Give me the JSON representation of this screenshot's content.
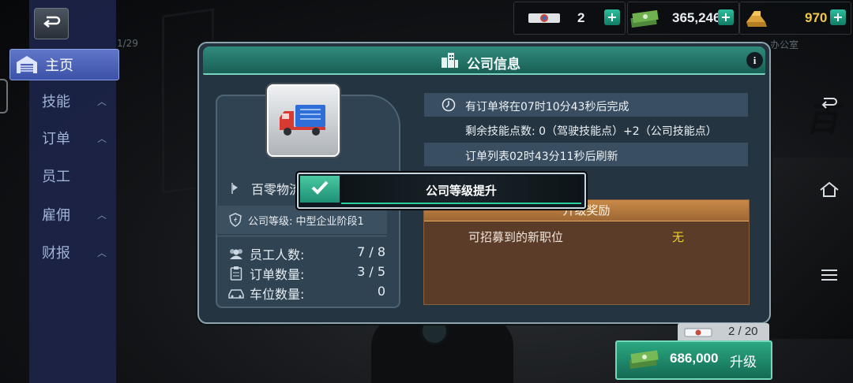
{
  "background": {
    "faded_counter": "1/29",
    "faded_office_label": "办公室",
    "big_glyph": "百"
  },
  "top_bar": {
    "tickets": {
      "value": "2",
      "icon": "ticket-icon"
    },
    "cash": {
      "value": "365,246",
      "icon": "cash-stack-icon"
    },
    "gold": {
      "value": "970",
      "icon": "gold-bars-icon"
    }
  },
  "sidebar": {
    "back_icon": "back-arrow-icon",
    "items": [
      {
        "label": "主页",
        "active": true,
        "icon": "warehouse-icon"
      },
      {
        "label": "技能",
        "expandable": true
      },
      {
        "label": "订单",
        "expandable": true
      },
      {
        "label": "员工",
        "expandable": false
      },
      {
        "label": "雇佣",
        "expandable": true
      },
      {
        "label": "财报",
        "expandable": true
      }
    ]
  },
  "dialog": {
    "title": "公司信息",
    "title_icon": "buildings-icon",
    "info_button": "i",
    "company_name": "百零物流",
    "company_level_label": "公司等级: 中型企业阶段1",
    "stats": [
      {
        "label": "员工人数:",
        "value": "7 / 8",
        "icon": "people-icon"
      },
      {
        "label": "订单数量:",
        "value": "3 / 5",
        "icon": "clipboard-icon"
      },
      {
        "label": "车位数量:",
        "value": "0",
        "icon": "car-icon"
      }
    ],
    "info_lines": [
      "有订单将在07时10分43秒后完成",
      "剩余技能点数: 0（驾驶技能点）+2（公司技能点）",
      "订单列表02时43分11秒后刷新"
    ],
    "reward": {
      "header": "升级奖励",
      "row_label": "可招募到的新职位",
      "row_value": "无"
    }
  },
  "toast": {
    "text": "公司等级提升"
  },
  "upgrade": {
    "ticket_progress": "2 / 20",
    "price": "686,000",
    "label": "升级"
  },
  "colors": {
    "accent_teal": "#2f8b7c",
    "reward_orange": "#c98a48",
    "none_yellow": "#e9d21d"
  }
}
